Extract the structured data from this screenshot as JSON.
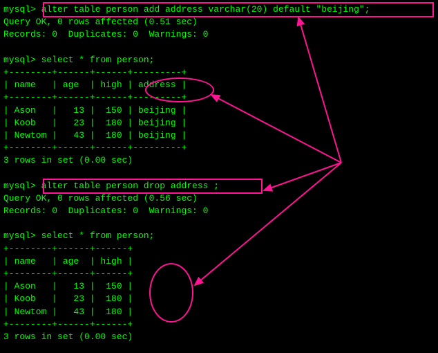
{
  "prompt": "mysql>",
  "commands": {
    "alter_add": "alter table person add address varchar(20) default \"beijing\";",
    "select1": "select * from person;",
    "alter_drop": "alter table person drop address ;",
    "select2": "select * from person;"
  },
  "responses": {
    "query_ok1": "Query OK, 0 rows affected (0.51 sec)",
    "records1": "Records: 0  Duplicates: 0  Warnings: 0",
    "query_ok2": "Query OK, 0 rows affected (0.56 sec)",
    "records2": "Records: 0  Duplicates: 0  Warnings: 0",
    "rows_in_set": "3 rows in set (0.00 sec)"
  },
  "table1": {
    "border_top": "+--------+------+------+---------+",
    "header": "| name   | age  | high | address |",
    "rows": [
      "| Ason   |   13 |  150 | beijing |",
      "| Koob   |   23 |  180 | beijing |",
      "| Newtom |   43 |  180 | beijing |"
    ]
  },
  "table2": {
    "border_top": "+--------+------+------+",
    "header": "| name   | age  | high |",
    "rows": [
      "| Ason   |   13 |  150 |",
      "| Koob   |   23 |  180 |",
      "| Newtom |   43 |  180 |"
    ]
  },
  "chart_data": {
    "type": "table",
    "title": "person table before and after dropping address column",
    "before": {
      "columns": [
        "name",
        "age",
        "high",
        "address"
      ],
      "rows": [
        {
          "name": "Ason",
          "age": 13,
          "high": 150,
          "address": "beijing"
        },
        {
          "name": "Koob",
          "age": 23,
          "high": 180,
          "address": "beijing"
        },
        {
          "name": "Newtom",
          "age": 43,
          "high": 180,
          "address": "beijing"
        }
      ]
    },
    "after": {
      "columns": [
        "name",
        "age",
        "high"
      ],
      "rows": [
        {
          "name": "Ason",
          "age": 13,
          "high": 150
        },
        {
          "name": "Koob",
          "age": 23,
          "high": 180
        },
        {
          "name": "Newtom",
          "age": 43,
          "high": 180
        }
      ]
    }
  }
}
